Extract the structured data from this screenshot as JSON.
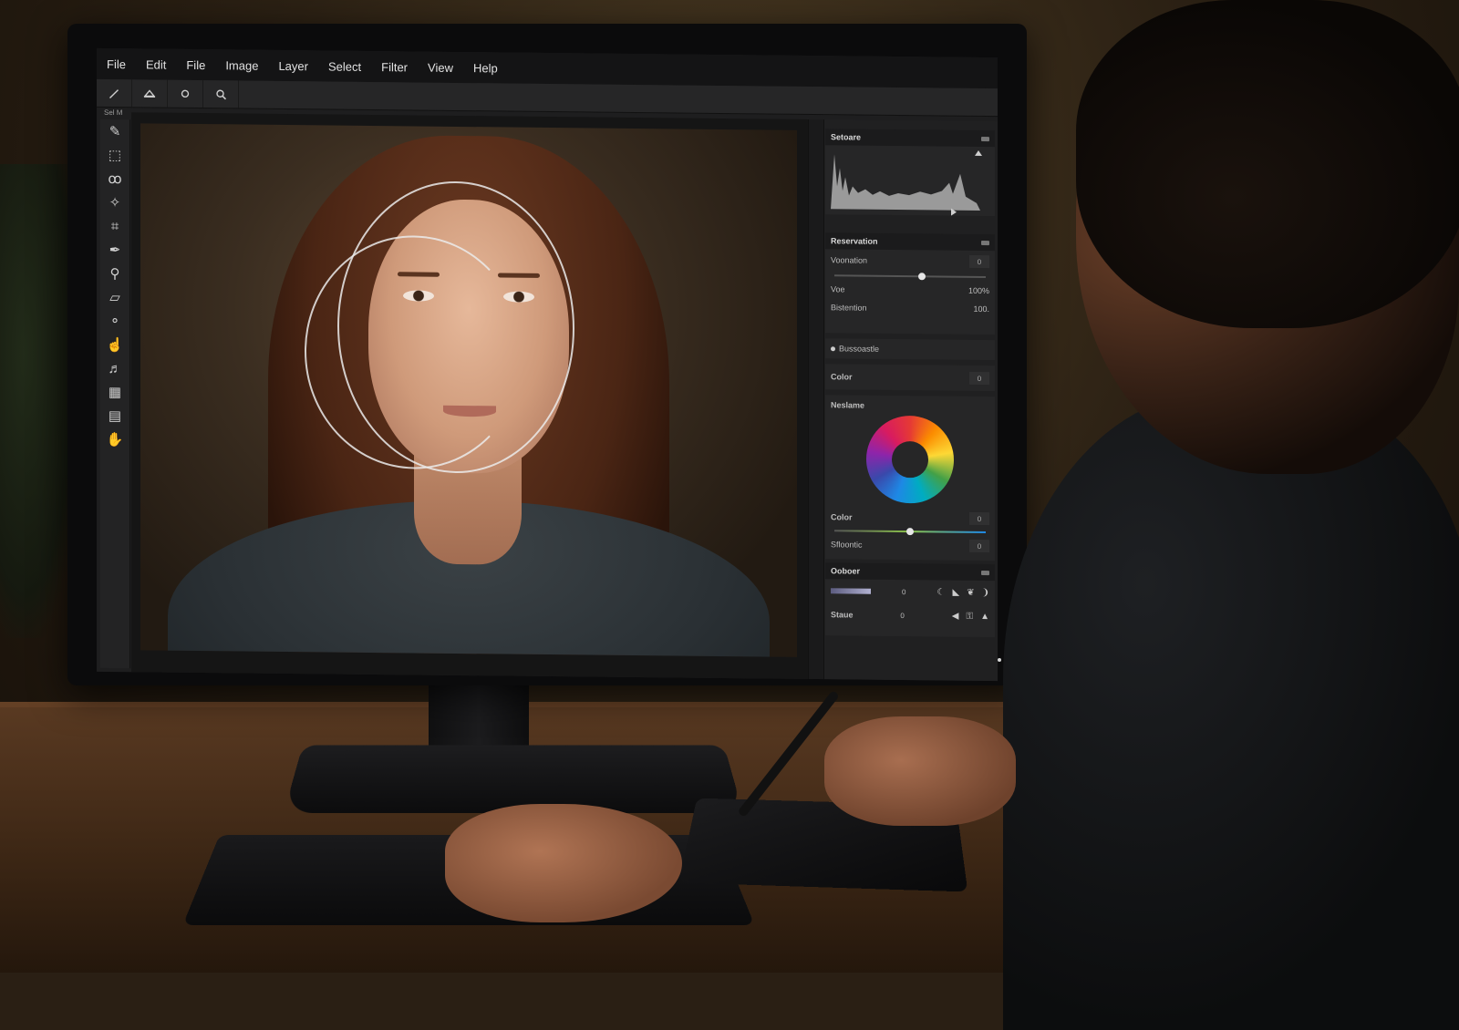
{
  "menubar": {
    "items": [
      "File",
      "Edit",
      "File",
      "Image",
      "Layer",
      "Select",
      "Filter",
      "View",
      "Help"
    ]
  },
  "options_bar": {
    "tools": [
      "brush-icon",
      "hill-icon",
      "circle-icon",
      "zoom-icon"
    ]
  },
  "document": {
    "tab_label": "Sel M"
  },
  "toolbox": {
    "tools": [
      "brush",
      "marquee",
      "lasso",
      "magic-wand",
      "crop",
      "pen",
      "eyedropper",
      "eraser",
      "dodge",
      "smudge",
      "text",
      "shape",
      "layers",
      "hand"
    ]
  },
  "panels": {
    "histogram": {
      "title": "Setoare"
    },
    "adjust": {
      "title": "Reservation",
      "rows": [
        {
          "label": "Voonation",
          "value": "0",
          "slider": 0.58
        },
        {
          "label": "Voe",
          "value": "100%",
          "slider": null
        },
        {
          "label": "Bistention",
          "value": "100.",
          "slider": null
        }
      ],
      "checkbox_label": "Bussoastle"
    },
    "color": {
      "label": "Color",
      "value": "0"
    },
    "wheel": {
      "title": "Neslame",
      "rows": [
        {
          "label": "Color",
          "value": "0",
          "slider": 0.5
        },
        {
          "label": "Sfloontic",
          "value": "0"
        }
      ]
    },
    "other": {
      "title": "Ooboer",
      "row1_value": "0",
      "row2_label": "Staue",
      "row2_value": "0"
    }
  },
  "colors": {
    "app_bg": "#1e1e1f",
    "menubar_bg": "#141415",
    "panel_bg": "#262627",
    "selection_ring": "#ebebeb"
  }
}
